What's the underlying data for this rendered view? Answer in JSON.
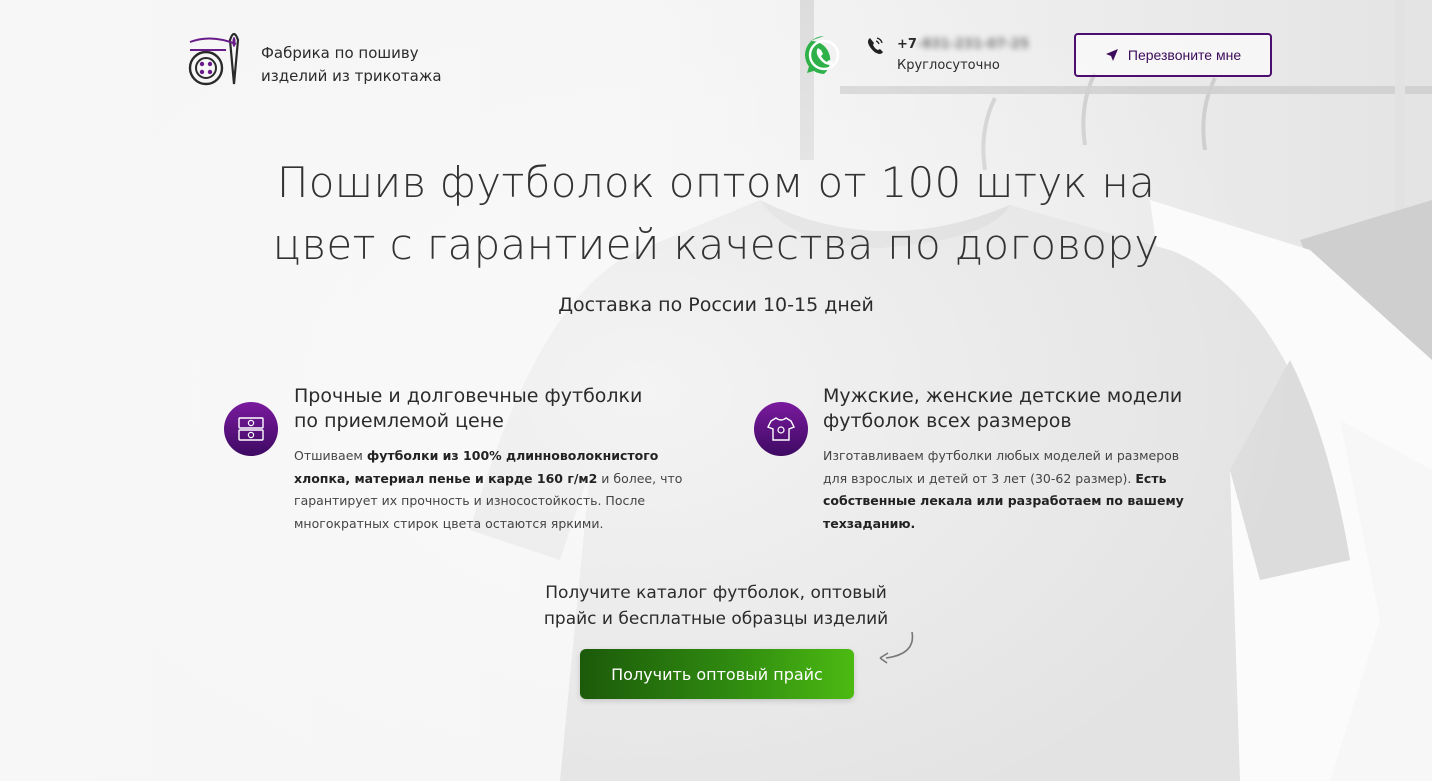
{
  "header": {
    "brand_line1": "Фабрика по пошиву",
    "brand_line2": "изделий из трикотажа",
    "phone_prefix": "+7",
    "phone_rest": "-831-231-07-25",
    "hours": "Круглосуточно",
    "callback_label": "Перезвоните мне"
  },
  "hero": {
    "title_line1": "Пошив футболок оптом от 100 штук на",
    "title_line2": "цвет с гарантией качества по договору",
    "subtitle": "Доставка по России 10-15 дней"
  },
  "features": [
    {
      "title_line1": "Прочные и долговечные футболки",
      "title_line2": "по приемлемой цене",
      "text_a": "Отшиваем ",
      "text_bold": "футболки из 100% длинноволокнистого хлопка, материал пенье и карде 160 г/м2",
      "text_b": " и более,  что гарантирует их прочность и износостойкость. После многократных стирок цвета остаются яркими."
    },
    {
      "title_line1": "Мужские, женские детские модели",
      "title_line2": "футболок всех размеров",
      "text_a": "Изготавливаем футболки любых моделей и размеров для взрослых и детей от 3 лет (30-62 размер). ",
      "text_bold": "Есть собственные лекала или разработаем по вашему техзаданию."
    }
  ],
  "cta": {
    "line1": "Получите каталог футболок, оптовый",
    "line2": "прайс и бесплатные образцы изделий",
    "button_label": "Получить оптовый прайс"
  },
  "colors": {
    "accent_purple": "#4b0d6e",
    "cta_green": "#2f8a10",
    "whatsapp_green": "#2fb14a"
  }
}
